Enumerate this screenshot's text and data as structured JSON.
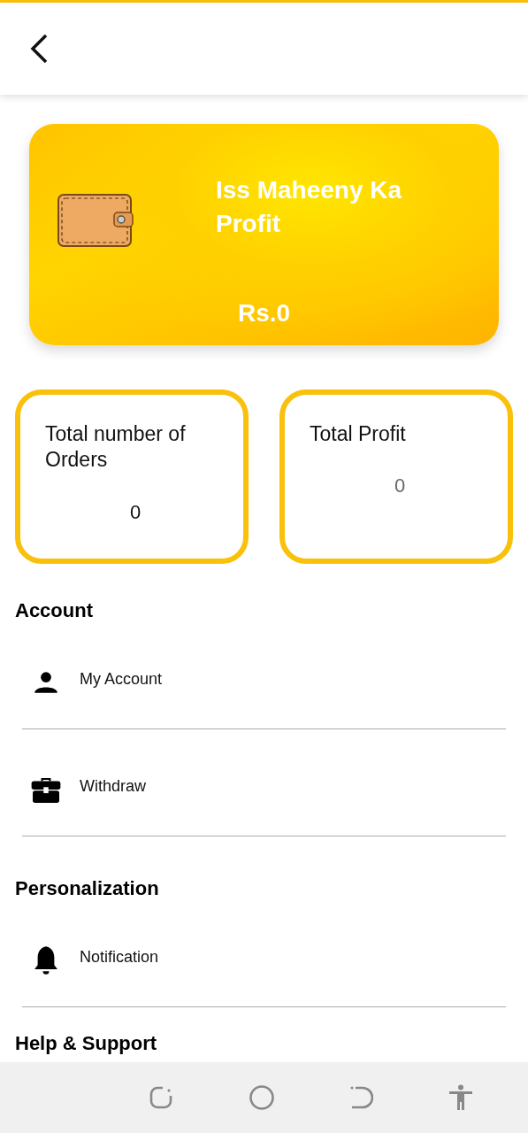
{
  "balance_card": {
    "title": "Iss Maheeny Ka Profit",
    "amount": "Rs.0"
  },
  "stats": [
    {
      "label": "Total number of Orders",
      "value": "0"
    },
    {
      "label": "Total Profit",
      "value": "0"
    }
  ],
  "sections": [
    {
      "title": "Account",
      "items": [
        {
          "label": "My Account"
        },
        {
          "label": "Withdraw"
        }
      ]
    },
    {
      "title": "Personalization",
      "items": [
        {
          "label": "Notification"
        }
      ]
    },
    {
      "title": "Help & Support"
    }
  ]
}
